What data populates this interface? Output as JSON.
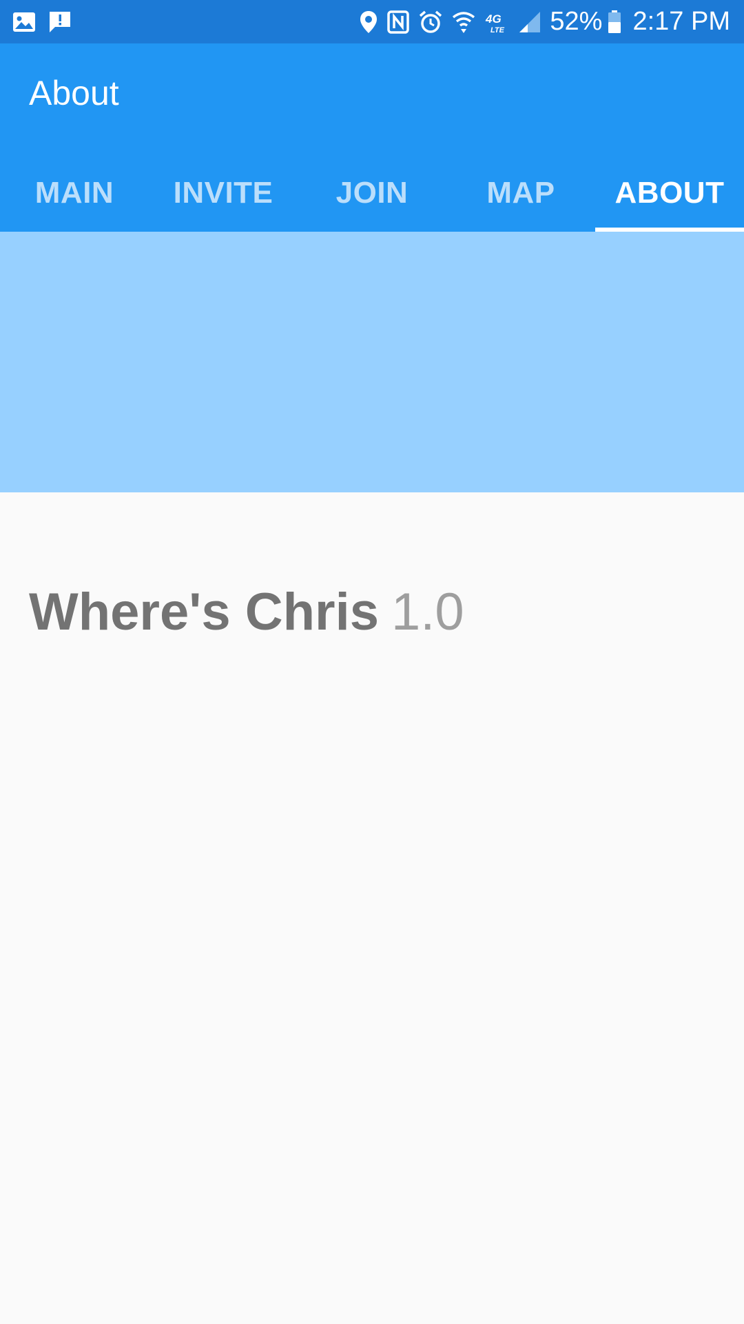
{
  "status_bar": {
    "left_icons": [
      "gallery-icon",
      "message-alert-icon"
    ],
    "right_icons": [
      "location-icon",
      "nfc-icon",
      "alarm-icon",
      "wifi-icon",
      "lte-icon",
      "signal-icon",
      "battery-icon"
    ],
    "network_label": "4G",
    "battery_percent": "52%",
    "time": "2:17 PM"
  },
  "app_bar": {
    "title": "About",
    "background_color": "#2196F3",
    "status_color": "#1C7AD6"
  },
  "tabs": [
    {
      "label": "MAIN",
      "active": false
    },
    {
      "label": "INVITE",
      "active": false
    },
    {
      "label": "JOIN",
      "active": false
    },
    {
      "label": "MAP",
      "active": false
    },
    {
      "label": "ABOUT",
      "active": true
    }
  ],
  "banner": {
    "color": "#97D0FF"
  },
  "about": {
    "app_name": "Where's Chris",
    "version": "1.0"
  }
}
